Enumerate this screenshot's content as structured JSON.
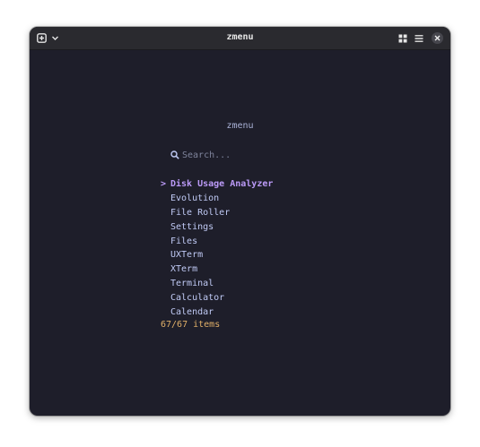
{
  "window": {
    "title": "zmenu"
  },
  "app": {
    "header": "zmenu",
    "search": {
      "placeholder": "Search...",
      "value": ""
    },
    "selected_marker": ">",
    "items": [
      {
        "label": "Disk Usage Analyzer",
        "selected": true
      },
      {
        "label": "Evolution",
        "selected": false
      },
      {
        "label": "File Roller",
        "selected": false
      },
      {
        "label": "Settings",
        "selected": false
      },
      {
        "label": "Files",
        "selected": false
      },
      {
        "label": "UXTerm",
        "selected": false
      },
      {
        "label": "XTerm",
        "selected": false
      },
      {
        "label": "Terminal",
        "selected": false
      },
      {
        "label": "Calculator",
        "selected": false
      },
      {
        "label": "Calendar",
        "selected": false
      }
    ],
    "count": "67/67 items"
  },
  "colors": {
    "background": "#1e1e2a",
    "titlebar": "#2a2a2f",
    "item_text": "#c0caf5",
    "selected_text": "#bb9af7",
    "count_text": "#e0af68",
    "header_text": "#a9b1d6"
  },
  "icons": {
    "titlebar_left": [
      "new-tab-icon",
      "chevron-down-icon"
    ],
    "titlebar_right": [
      "grid-icon",
      "hamburger-menu-icon",
      "close-icon"
    ],
    "search": "search-icon"
  }
}
